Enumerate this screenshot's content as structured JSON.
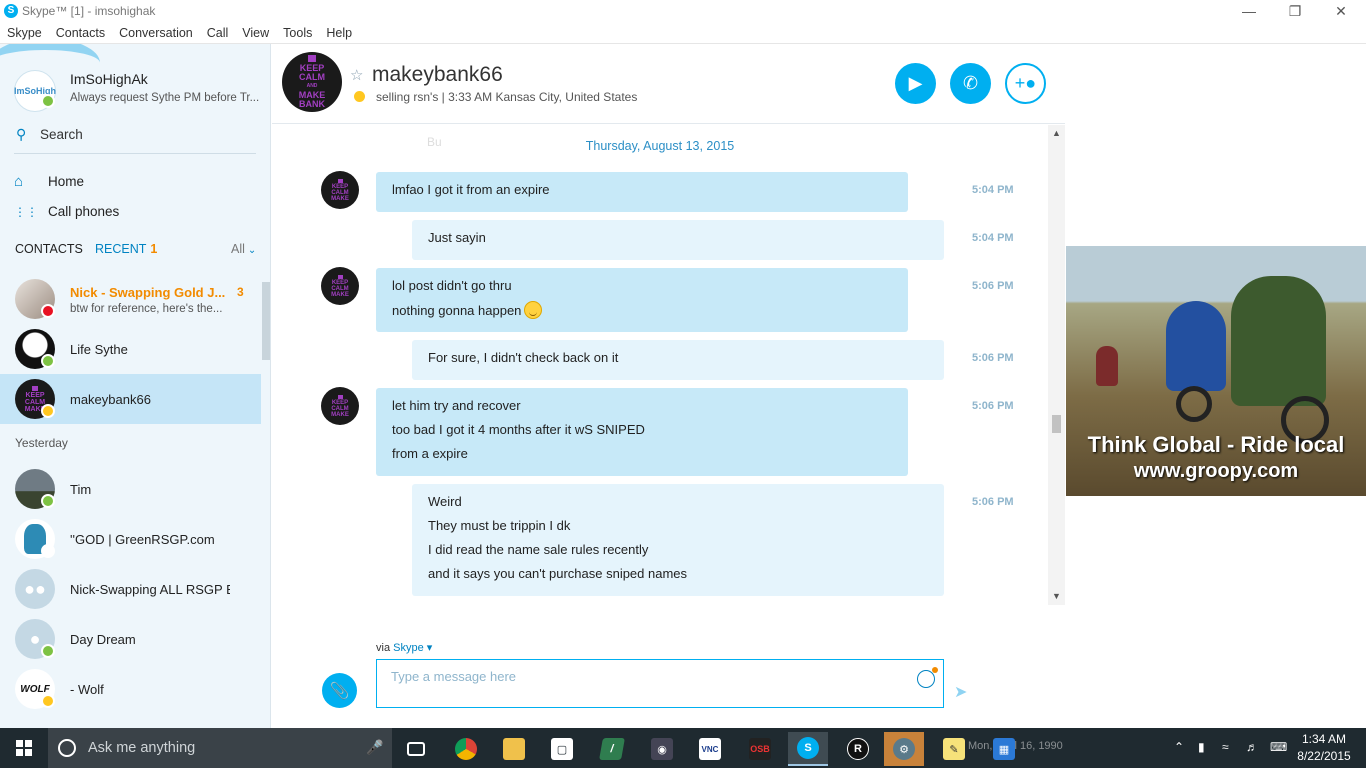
{
  "window": {
    "title": "Skype™ [1] - imsohighak",
    "app_icon": "S",
    "buttons": {
      "minimize": "—",
      "restore": "❐",
      "close": "✕"
    }
  },
  "menu": [
    "Skype",
    "Contacts",
    "Conversation",
    "Call",
    "View",
    "Tools",
    "Help"
  ],
  "profile": {
    "name": "ImSoHighAk",
    "mood": "Always request Sythe PM before Tr...",
    "avatar_text": "ImSoHigh",
    "status": "online"
  },
  "sidebar": {
    "search_label": "Search",
    "nav": [
      {
        "label": "Home",
        "icon": "home-icon"
      },
      {
        "label": "Call phones",
        "icon": "dialpad-icon"
      }
    ],
    "tabs": {
      "contacts": "CONTACTS",
      "recent": "RECENT",
      "recent_count": "1",
      "filter": "All"
    },
    "section_yesterday": "Yesterday"
  },
  "contacts": [
    {
      "name": "Nick - Swapping Gold J...",
      "sub": "btw for reference, here's the...",
      "badge": "3",
      "status": "dnd",
      "unread": true
    },
    {
      "name": "Life Sythe",
      "sub": "",
      "status": "online"
    },
    {
      "name": "makeybank66",
      "sub": "",
      "status": "away",
      "selected": true
    },
    {
      "name": "Tim",
      "sub": "",
      "status": "online"
    },
    {
      "name": "''GOD | GreenRSGP.com",
      "sub": "",
      "status": "offline"
    },
    {
      "name": "Nick-Swapping ALL RSGP Bu...",
      "sub": "",
      "status": "none"
    },
    {
      "name": "Day Dream",
      "sub": "",
      "status": "online"
    },
    {
      "name": "- Wolf",
      "sub": "",
      "status": "away"
    }
  ],
  "chat": {
    "contact_name": "makeybank66",
    "mood": "selling rsn's",
    "location_time": "3:33 AM Kansas City, United States",
    "avatar_lines": [
      "KEEP",
      "CALM",
      "AND",
      "MAKE",
      "BANK"
    ],
    "faint_text": "Bu",
    "date": "Thursday, August 13, 2015",
    "messages": [
      {
        "from": "them",
        "time": "5:04 PM",
        "lines": [
          "lmfao I got it from an expire"
        ]
      },
      {
        "from": "me",
        "time": "5:04 PM",
        "lines": [
          "Just sayin"
        ]
      },
      {
        "from": "them",
        "time": "5:06 PM",
        "lines": [
          "lol post didn't go thru",
          "nothing gonna happen"
        ]
      },
      {
        "from": "me",
        "time": "5:06 PM",
        "lines": [
          "For sure, I didn't check back on it"
        ]
      },
      {
        "from": "them",
        "time": "5:06 PM",
        "lines": [
          "let him try and recover",
          "too bad I got it 4 months after it wS SNIPED",
          "from a expire"
        ]
      },
      {
        "from": "me",
        "time": "5:06 PM",
        "lines": [
          "Weird",
          "They must be trippin I dk",
          "I did read the name sale rules recently",
          "and it says you can't purchase sniped names"
        ]
      }
    ],
    "via_label": "via",
    "via_service": "Skype",
    "input_placeholder": "Type a message here"
  },
  "ad": {
    "line1": "Think Global - Ride local",
    "line2": "www.groopy.com"
  },
  "taskbar": {
    "search_text": "Ask me anything",
    "clock_time": "1:34 AM",
    "clock_date": "8/22/2015",
    "ghost_text": "Mon, April 16, 1990"
  },
  "colors": {
    "accent": "#00aff0",
    "bubble_them": "#c7e9f8",
    "bubble_me": "#e5f4fc",
    "unread": "#f28b00",
    "online": "#7dc243",
    "away": "#ffc720",
    "dnd": "#e81123"
  }
}
